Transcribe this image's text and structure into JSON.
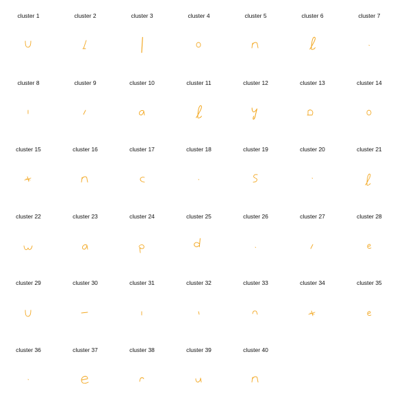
{
  "colors": {
    "stroke": "#f2a61e",
    "label": "#111111",
    "background": "#ffffff"
  },
  "clusters": [
    {
      "label": "cluster 1",
      "glyph": "u-letter"
    },
    {
      "label": "cluster 2",
      "glyph": "slash-stroke"
    },
    {
      "label": "cluster 3",
      "glyph": "vertical-stroke"
    },
    {
      "label": "cluster 4",
      "glyph": "o-letter"
    },
    {
      "label": "cluster 5",
      "glyph": "n-letter"
    },
    {
      "label": "cluster 6",
      "glyph": "l-loop"
    },
    {
      "label": "cluster 7",
      "glyph": "dot"
    },
    {
      "label": "cluster 8",
      "glyph": "short-vertical"
    },
    {
      "label": "cluster 9",
      "glyph": "short-slash"
    },
    {
      "label": "cluster 10",
      "glyph": "a-letter"
    },
    {
      "label": "cluster 11",
      "glyph": "l-loop"
    },
    {
      "label": "cluster 12",
      "glyph": "y-letter"
    },
    {
      "label": "cluster 13",
      "glyph": "d-like"
    },
    {
      "label": "cluster 14",
      "glyph": "o-letter"
    },
    {
      "label": "cluster 15",
      "glyph": "scribble-cross"
    },
    {
      "label": "cluster 16",
      "glyph": "n-letter"
    },
    {
      "label": "cluster 17",
      "glyph": "c-letter"
    },
    {
      "label": "cluster 18",
      "glyph": "dot"
    },
    {
      "label": "cluster 19",
      "glyph": "s-letter"
    },
    {
      "label": "cluster 20",
      "glyph": "dot"
    },
    {
      "label": "cluster 21",
      "glyph": "l-loop"
    },
    {
      "label": "cluster 22",
      "glyph": "w-letter"
    },
    {
      "label": "cluster 23",
      "glyph": "a-letter"
    },
    {
      "label": "cluster 24",
      "glyph": "p-letter"
    },
    {
      "label": "cluster 25",
      "glyph": "d-letter"
    },
    {
      "label": "cluster 26",
      "glyph": "dot"
    },
    {
      "label": "cluster 27",
      "glyph": "short-slash"
    },
    {
      "label": "cluster 28",
      "glyph": "e-small"
    },
    {
      "label": "cluster 29",
      "glyph": "u-letter"
    },
    {
      "label": "cluster 30",
      "glyph": "dash"
    },
    {
      "label": "cluster 31",
      "glyph": "short-vertical"
    },
    {
      "label": "cluster 32",
      "glyph": "tiny-stroke"
    },
    {
      "label": "cluster 33",
      "glyph": "small-n"
    },
    {
      "label": "cluster 34",
      "glyph": "scribble-cross"
    },
    {
      "label": "cluster 35",
      "glyph": "e-small"
    },
    {
      "label": "cluster 36",
      "glyph": "dot"
    },
    {
      "label": "cluster 37",
      "glyph": "e-letter"
    },
    {
      "label": "cluster 38",
      "glyph": "r-letter"
    },
    {
      "label": "cluster 39",
      "glyph": "small-u"
    },
    {
      "label": "cluster 40",
      "glyph": "n-letter"
    }
  ]
}
